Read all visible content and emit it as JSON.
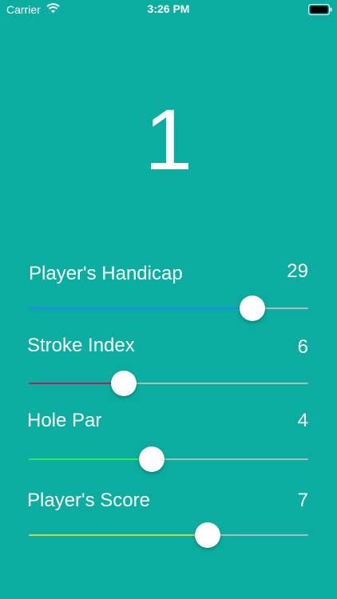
{
  "status_bar": {
    "carrier": "Carrier",
    "time": "3:26 PM",
    "wifi_icon": "wifi-icon",
    "battery_icon": "battery-icon"
  },
  "result": {
    "value": "1"
  },
  "sliders": [
    {
      "label": "Player's Handicap",
      "value": "29",
      "fill_fraction": 0.8,
      "fill_color": "#1e88ff"
    },
    {
      "label": "Stroke Index",
      "value": "6",
      "fill_fraction": 0.34,
      "fill_color": "#c2185b"
    },
    {
      "label": "Hole Par",
      "value": "4",
      "fill_fraction": 0.44,
      "fill_color": "#39e84f"
    },
    {
      "label": "Player's Score",
      "value": "7",
      "fill_fraction": 0.64,
      "fill_color": "#d9cf3a"
    }
  ],
  "colors": {
    "background": "#0bada0",
    "track": "#b6b6b6",
    "thumb": "#ffffff"
  }
}
